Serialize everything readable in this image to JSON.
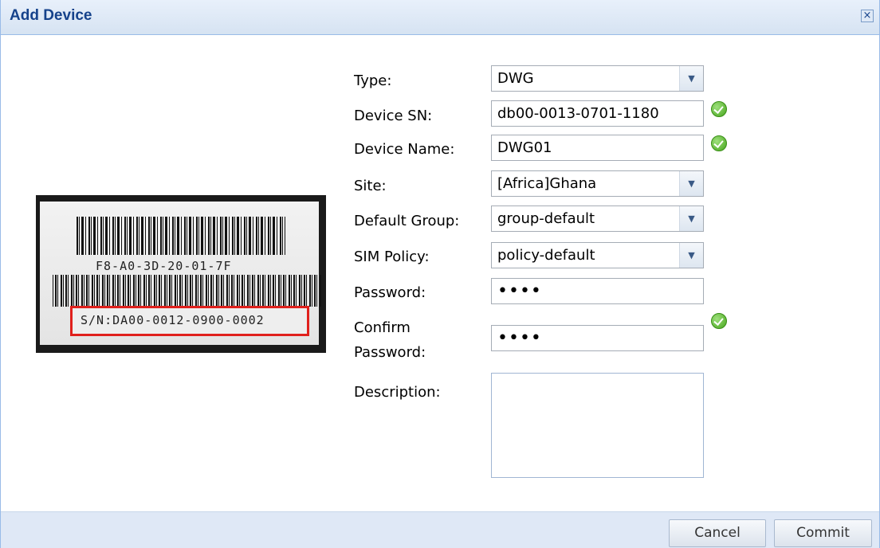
{
  "dialog": {
    "title": "Add Device",
    "close_icon": "close-icon"
  },
  "label_image": {
    "mac": "F8-A0-3D-20-01-7F",
    "serial": "S/N:DA00-0012-0900-0002",
    "highlight_color": "#e0201c"
  },
  "form": {
    "type": {
      "label": "Type:",
      "value": "DWG"
    },
    "device_sn": {
      "label": "Device SN:",
      "value": "db00-0013-0701-1180",
      "valid": true
    },
    "device_name": {
      "label": "Device Name:",
      "value": "DWG01",
      "valid": true
    },
    "site": {
      "label": "Site:",
      "value": "[Africa]Ghana"
    },
    "default_group": {
      "label": "Default Group:",
      "value": "group-default"
    },
    "sim_policy": {
      "label": "SIM Policy:",
      "value": "policy-default"
    },
    "password": {
      "label": "Password:",
      "value": "••••"
    },
    "confirm_password": {
      "label_line1": "Confirm",
      "label_line2": "Password:",
      "value": "••••",
      "valid": true
    },
    "description": {
      "label": "Description:",
      "value": ""
    }
  },
  "footer": {
    "cancel_label": "Cancel",
    "commit_label": "Commit"
  },
  "colors": {
    "title": "#15428b",
    "valid": "#46a51c",
    "footer_bg": "#dfe8f6"
  }
}
